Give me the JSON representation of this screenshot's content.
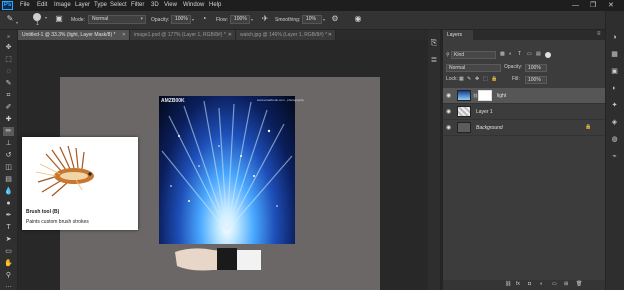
{
  "menu": {
    "logo": "Ps",
    "items": [
      "File",
      "Edit",
      "Image",
      "Layer",
      "Type",
      "Select",
      "Filter",
      "3D",
      "View",
      "Window",
      "Help"
    ],
    "window_controls": {
      "minimize": "—",
      "restore": "❐",
      "close": "✕"
    }
  },
  "options": {
    "brush_size": "1",
    "mode_label": "Mode:",
    "mode_value": "Normal",
    "opacity_label": "Opacity:",
    "opacity_value": "100%",
    "flow_label": "Flow:",
    "flow_value": "100%",
    "smoothing_label": "Smoothing:",
    "smoothing_value": "10%"
  },
  "tabs": [
    {
      "label": "Untitled-1 @ 33.3% (light, Layer Mask/8) *",
      "active": true
    },
    {
      "label": "image1.psd @ 177% (Layer 1, RGB/8#) *",
      "active": false
    },
    {
      "label": "watch.jpg @ 146% (Layer 1, RGB/8#) *",
      "active": false
    }
  ],
  "document": {
    "image_logo": "AMZB00K",
    "image_meta": "www.amazbook.com · photography"
  },
  "tooltip": {
    "title": "Brush tool (B)",
    "description": "Paints custom brush strokes"
  },
  "layers_panel": {
    "tab_label": "Layers",
    "kind_label": "Kind",
    "blend_mode": "Normal",
    "opacity_label": "Opacity:",
    "opacity_value": "100%",
    "lock_label": "Lock:",
    "fill_label": "Fill:",
    "fill_value": "100%",
    "layers": [
      {
        "name": "light",
        "selected": true
      },
      {
        "name": "Layer 1",
        "selected": false
      },
      {
        "name": "Background",
        "selected": false
      }
    ]
  },
  "colors": {
    "accent": "#31a8ff",
    "panel_bg": "#3c3c3c",
    "canvas_bg": "#282828",
    "document_bg": "#6b6767"
  }
}
